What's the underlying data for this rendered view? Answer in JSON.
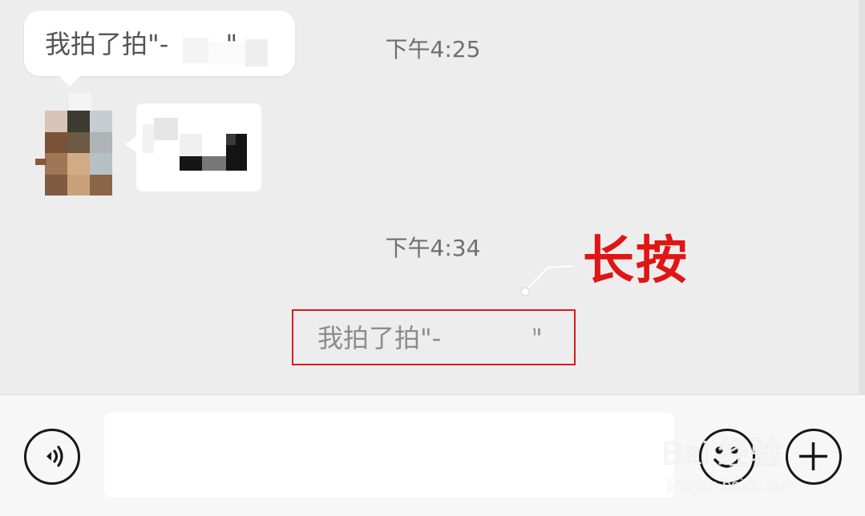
{
  "popup": {
    "text": "我拍了拍\"-       \""
  },
  "messages": [
    {
      "timestamp": "下午4:25"
    },
    {
      "timestamp": "下午4:34"
    }
  ],
  "system_message": {
    "text": "我拍了拍\"-          .\""
  },
  "annotation": {
    "label": "长按",
    "color": "#e01515"
  },
  "input_bar": {
    "voice_icon": "voice-icon",
    "emoji_icon": "emoji-icon",
    "plus_icon": "plus-icon",
    "input_value": ""
  },
  "watermark": {
    "main": "Bai 经验",
    "sub": "jingyan.baidu.com"
  },
  "colors": {
    "chat_background": "#ededed",
    "bubble": "#ffffff",
    "highlight_border": "#d81b1b"
  }
}
